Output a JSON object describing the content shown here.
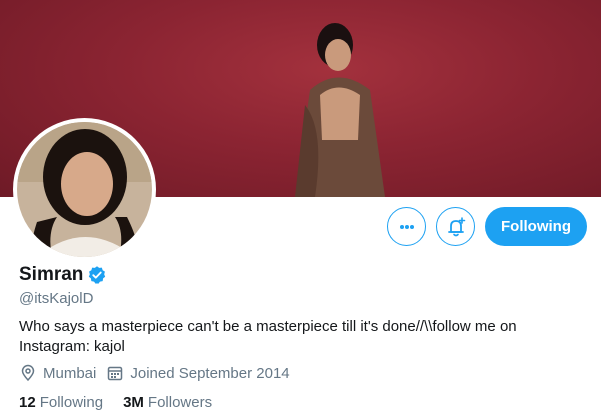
{
  "profile": {
    "name": "Simran",
    "handle": "@itsKajolD",
    "bio": "Who says a masterpiece can't be a masterpiece till it's done//\\\\follow me on Instagram: kajol",
    "location": "Mumbai",
    "joined": "Joined September 2014",
    "verified": true
  },
  "actions": {
    "more_icon": "more-horizontal-icon",
    "notify_icon": "bell-plus-icon",
    "following_label": "Following"
  },
  "stats": {
    "following_count": "12",
    "following_label": "Following",
    "followers_count": "3M",
    "followers_label": "Followers"
  },
  "icons": {
    "location": "location-pin-icon",
    "calendar": "calendar-icon",
    "verified": "verified-badge-icon"
  },
  "colors": {
    "accent": "#1da1f2",
    "banner": "#8b2432",
    "muted": "#657786",
    "text": "#14171a"
  }
}
